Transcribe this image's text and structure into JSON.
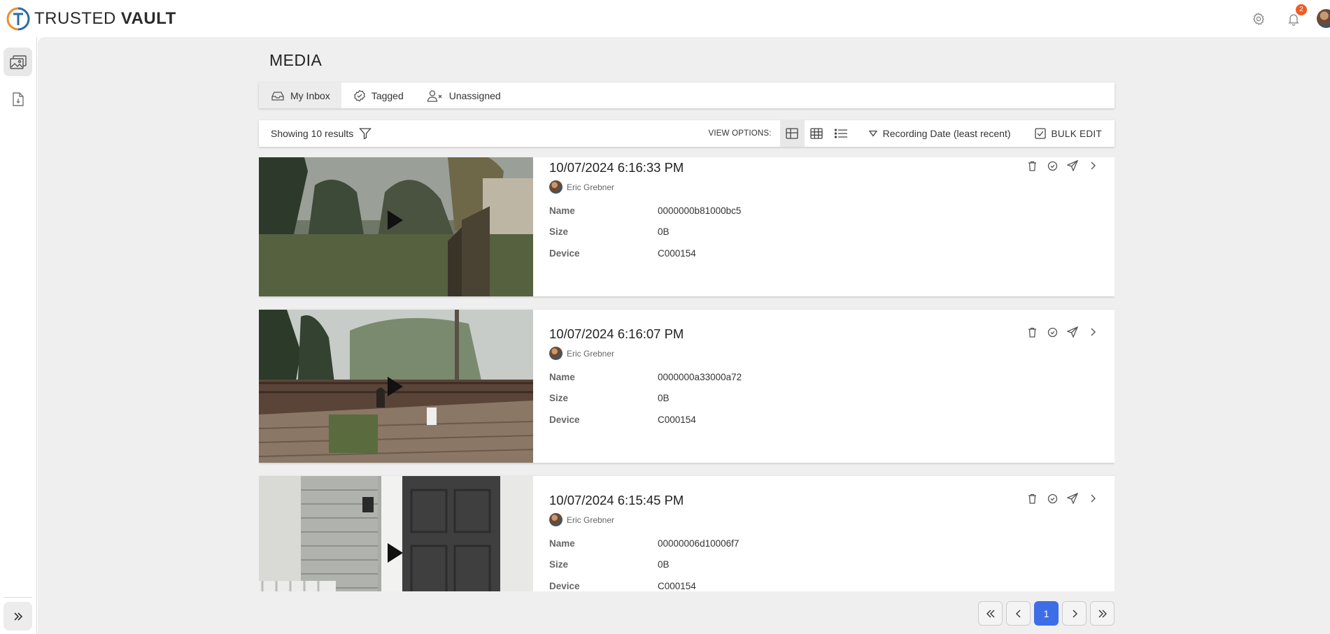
{
  "app": {
    "brand_part1": "TRUSTED",
    "brand_part2": "VAULT",
    "notification_count": "2",
    "accent_color": "#3d6ee8",
    "badge_color": "#f15a22"
  },
  "sidebar": {
    "items": [
      {
        "icon": "media-gallery-icon",
        "active": true
      },
      {
        "icon": "document-icon",
        "active": false
      }
    ],
    "expand_icon": "double-chevron-right-icon"
  },
  "page": {
    "title": "MEDIA"
  },
  "tabs": [
    {
      "label": "My Inbox",
      "icon": "inbox-icon",
      "active": true
    },
    {
      "label": "Tagged",
      "icon": "tag-check-icon",
      "active": false
    },
    {
      "label": "Unassigned",
      "icon": "user-x-icon",
      "active": false
    }
  ],
  "toolbar": {
    "results": "Showing 10 results",
    "view_options_label": "VIEW OPTIONS:",
    "sort_label": "Recording Date (least recent)",
    "bulk_edit_label": "BULK EDIT"
  },
  "media_fields": {
    "name_label": "Name",
    "size_label": "Size",
    "device_label": "Device"
  },
  "media": [
    {
      "title": "10/07/2024 6:16:33 PM",
      "owner": "Eric Grebner",
      "name": "0000000b81000bc5",
      "size": "0B",
      "device": "C000154"
    },
    {
      "title": "10/07/2024 6:16:07 PM",
      "owner": "Eric Grebner",
      "name": "0000000a33000a72",
      "size": "0B",
      "device": "C000154"
    },
    {
      "title": "10/07/2024 6:15:45 PM",
      "owner": "Eric Grebner",
      "name": "00000006d10006f7",
      "size": "0B",
      "device": "C000154"
    }
  ],
  "pagination": {
    "current": "1"
  }
}
